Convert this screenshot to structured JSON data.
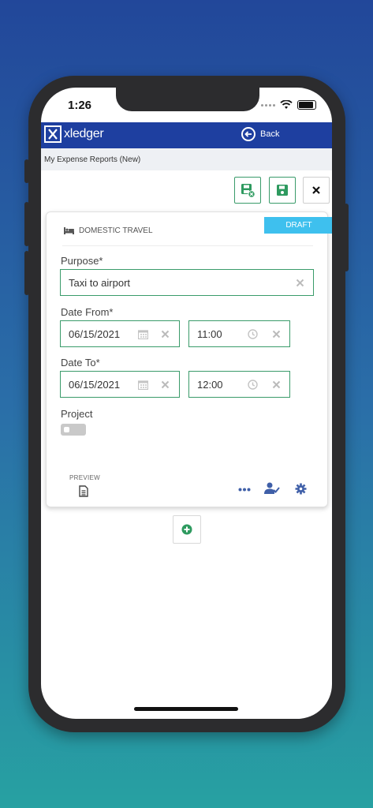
{
  "status_bar": {
    "time": "1:26"
  },
  "app": {
    "brand": "xledger",
    "back_label": "Back",
    "breadcrumb": "My Expense Reports (New)"
  },
  "toolbar": {
    "buttons": [
      {
        "name": "save-and-close",
        "icon": "save-close-icon"
      },
      {
        "name": "save",
        "icon": "save-icon"
      },
      {
        "name": "close",
        "icon": "close-icon"
      }
    ]
  },
  "expense": {
    "type": "DOMESTIC TRAVEL",
    "status": "DRAFT",
    "purpose": {
      "label": "Purpose*",
      "value": "Taxi to airport"
    },
    "date_from": {
      "label": "Date From*",
      "date": "06/15/2021",
      "time": "11:00"
    },
    "date_to": {
      "label": "Date To*",
      "date": "06/15/2021",
      "time": "12:00"
    },
    "project": {
      "label": "Project",
      "enabled": false
    },
    "preview_label": "PREVIEW"
  },
  "colors": {
    "brand_blue": "#1e3fa0",
    "field_border": "#3a9b6a",
    "draft_badge": "#3ec0ee",
    "action_icons": "#3f5fa8",
    "add_button": "#2e9a5f"
  }
}
